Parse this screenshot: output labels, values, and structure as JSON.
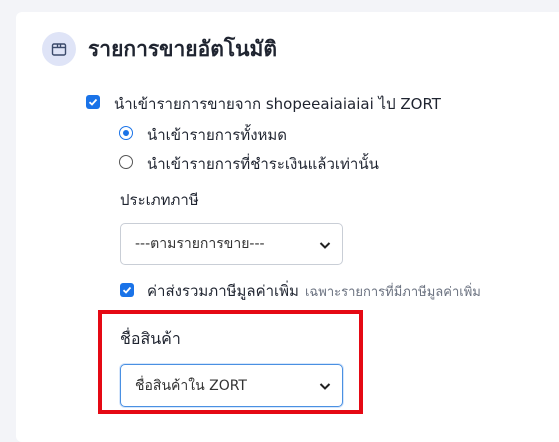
{
  "section": {
    "title": "รายการขายอัตโนมัติ",
    "icon": "box-icon"
  },
  "import_sales": {
    "checked": true,
    "label": "นำเข้ารายการขายจาก shopeeaiaiaiai ไป ZORT"
  },
  "import_scope": {
    "options": [
      {
        "label": "นำเข้ารายการทั้งหมด",
        "selected": true
      },
      {
        "label": "นำเข้ารายการที่ชำระเงินแล้วเท่านั้น",
        "selected": false
      }
    ]
  },
  "tax_type": {
    "label": "ประเภทภาษี",
    "value": "---ตามรายการขาย---"
  },
  "vat_option": {
    "checked": true,
    "label": "ค่าส่งรวมภาษีมูลค่าเพิ่ม",
    "hint": "เฉพาะรายการที่มีภาษีมูลค่าเพิ่ม"
  },
  "product_name": {
    "label": "ชื่อสินค้า",
    "value": "ชื่อสินค้าใน ZORT"
  },
  "colors": {
    "accent": "#1a73e8",
    "highlight": "#e50914",
    "icon_bg": "#dfe4f7"
  }
}
